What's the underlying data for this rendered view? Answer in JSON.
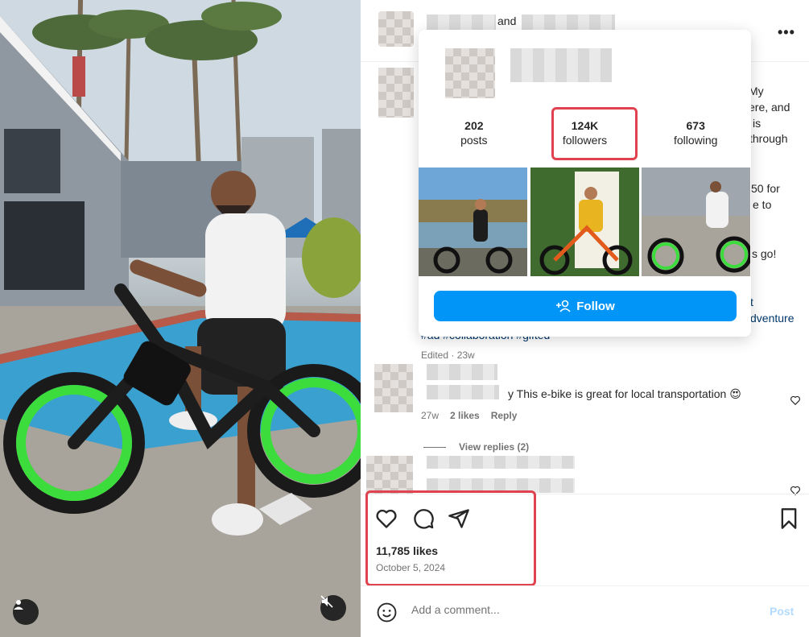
{
  "header": {
    "connector_text": "and"
  },
  "caption_fragments": {
    "line1": "My",
    "line2": "ere, and",
    "line3": "is",
    "line4": "through",
    "line5": "50 for",
    "line6": "e to",
    "line7": "s go!",
    "link1": "t",
    "link2": "dventure"
  },
  "caption_tags": "#ad #collaboration #gifted",
  "caption_edited": "Edited · 23w",
  "comment": {
    "text": "y This e-bike is great for local transportation 😍",
    "time": "27w",
    "likes": "2 likes",
    "reply": "Reply",
    "view_replies": "View replies (2)"
  },
  "profile_card": {
    "posts_count": "202",
    "posts_label": "posts",
    "followers_count": "124K",
    "followers_label": "followers",
    "following_count": "673",
    "following_label": "following",
    "follow_label": "Follow"
  },
  "post": {
    "likes": "11,785 likes",
    "date": "October 5, 2024"
  },
  "add_comment": {
    "placeholder": "Add a comment...",
    "post_label": "Post"
  },
  "colors": {
    "follow_blue": "#0095f6",
    "highlight_red": "#e0424f",
    "link_blue": "#00376b",
    "post_disabled": "#b3dbff"
  },
  "icons": [
    "more-icon",
    "heart-icon",
    "comment-icon",
    "share-icon",
    "bookmark-icon",
    "emoji-icon",
    "user-tag-icon",
    "mute-icon",
    "follow-user-icon"
  ]
}
